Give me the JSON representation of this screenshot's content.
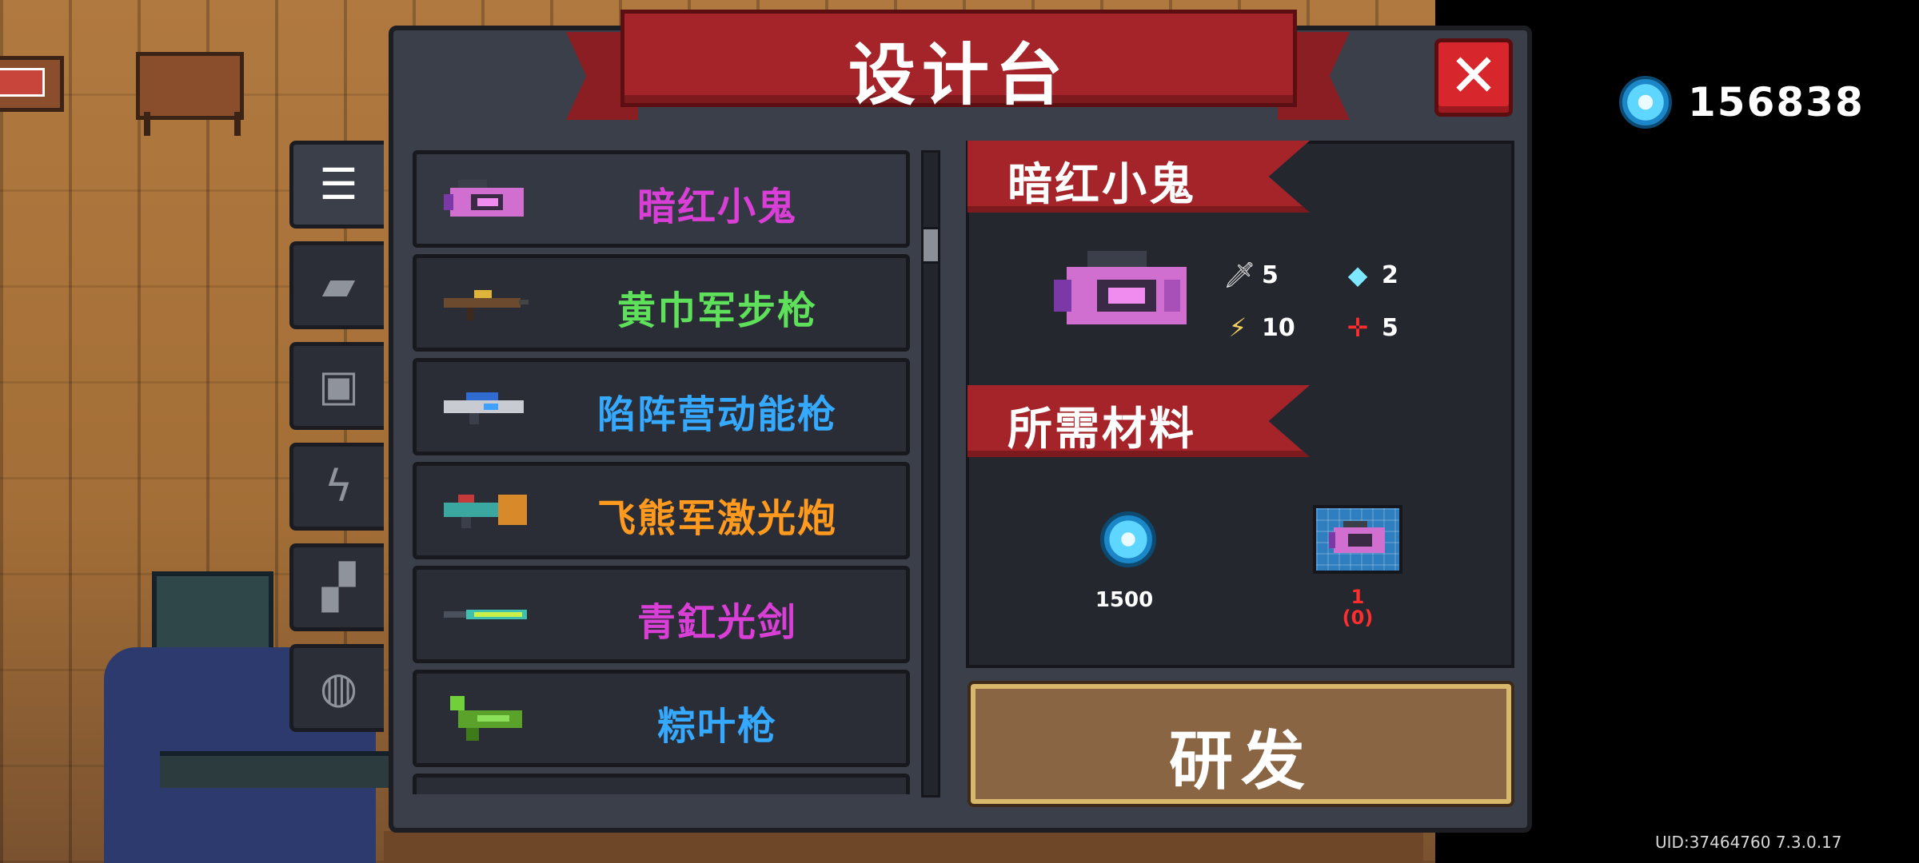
{
  "header": {
    "title": "设计台",
    "close_label": "✕"
  },
  "currency": {
    "icon": "gem-icon",
    "value": "156838"
  },
  "uid_text": "UID:37464760 7.3.0.17",
  "tabs": [
    {
      "icon": "list-icon",
      "glyph": "☰",
      "active": true
    },
    {
      "icon": "gun-icon",
      "glyph": "▰",
      "active": false
    },
    {
      "icon": "armor-icon",
      "glyph": "▣",
      "active": false
    },
    {
      "icon": "lightning-icon",
      "glyph": "ϟ",
      "active": false
    },
    {
      "icon": "pet-icon",
      "glyph": "▞",
      "active": false
    },
    {
      "icon": "helmet-icon",
      "glyph": "◍",
      "active": false
    }
  ],
  "items": [
    {
      "name": "暗红小鬼",
      "color": "#d93fd6"
    },
    {
      "name": "黄巾军步枪",
      "color": "#5fe05a"
    },
    {
      "name": "陷阵营动能枪",
      "color": "#35a9ff"
    },
    {
      "name": "飞熊军激光炮",
      "color": "#ff9a1f"
    },
    {
      "name": "青釭光剑",
      "color": "#d93fd6"
    },
    {
      "name": "粽叶枪",
      "color": "#35a9ff"
    }
  ],
  "detail": {
    "weapon_name": "暗红小鬼",
    "stats": {
      "damage": "5",
      "energy": "2",
      "crit": "10",
      "accuracy": "5"
    },
    "materials_title": "所需材料",
    "materials": {
      "gem_amount": "1500",
      "blueprint_needed": "1",
      "blueprint_owned": "(0)"
    },
    "research_label": "研发"
  }
}
